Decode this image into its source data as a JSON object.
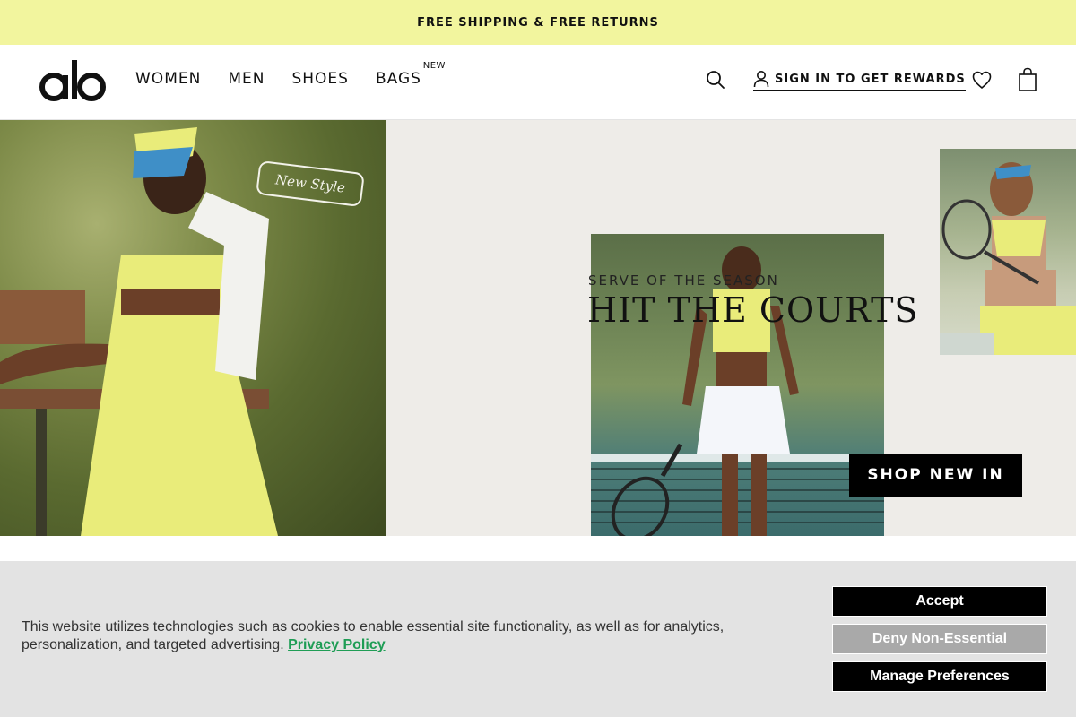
{
  "promo": {
    "text": "FREE SHIPPING & FREE RETURNS"
  },
  "header": {
    "logo": "alo",
    "nav": [
      {
        "label": "WOMEN"
      },
      {
        "label": "MEN"
      },
      {
        "label": "SHOES"
      },
      {
        "label": "BAGS",
        "badge": "NEW"
      }
    ],
    "signin_label": "SIGN IN TO GET REWARDS",
    "icons": {
      "search": "search-icon",
      "account": "user-icon",
      "wishlist": "heart-icon",
      "bag": "shopping-bag-icon"
    }
  },
  "hero": {
    "new_style_tag": "New Style",
    "eyebrow": "SERVE OF THE SEASON",
    "headline": "HIT THE COURTS",
    "cta": "SHOP NEW IN",
    "colors": {
      "accent_yellow": "#e9ec7a",
      "cta_bg": "#000000"
    }
  },
  "cookie": {
    "text": "This website utilizes technologies such as cookies to enable essential site functionality, as well as for analytics, personalization, and targeted advertising.",
    "link": "Privacy Policy",
    "accept": "Accept",
    "deny": "Deny Non-Essential",
    "manage": "Manage Preferences",
    "colors": {
      "link": "#1f9d55",
      "deny_bg": "#a9a9a9"
    }
  }
}
